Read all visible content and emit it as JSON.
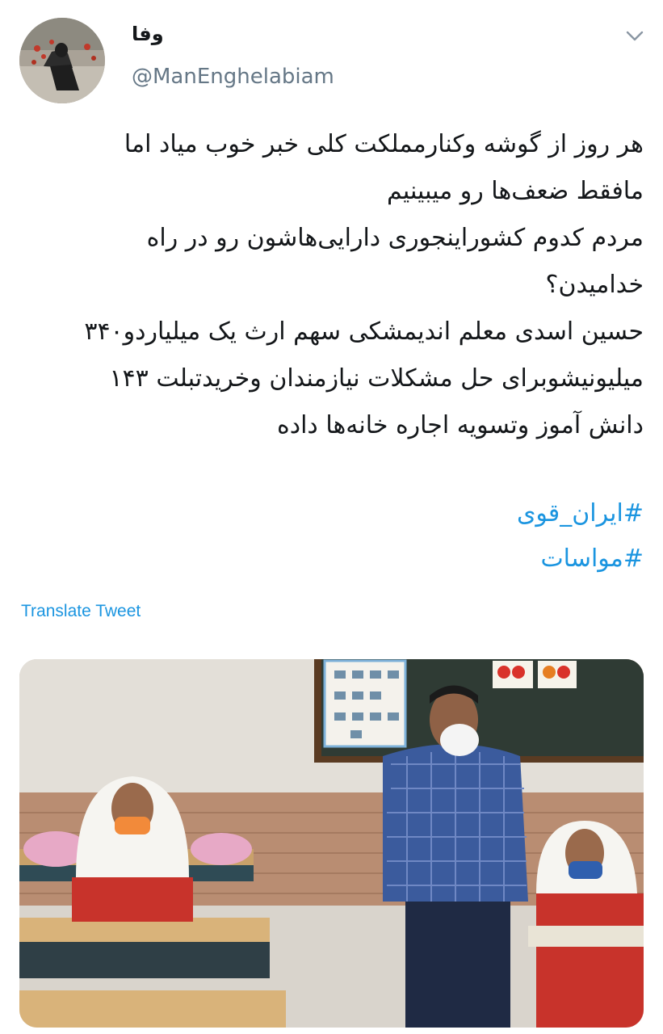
{
  "author": {
    "display_name": "وفا",
    "handle": "@ManEnghelabiam",
    "avatar_icon": "avatar-photo"
  },
  "menu": {
    "caret_icon": "chevron-down-icon"
  },
  "tweet": {
    "lines": [
      "هر روز از گوشه وکنارمملکت کلی خبر خوب میاد اما",
      "مافقط ضعف‌ها رو میبینیم",
      " مردم کدوم کشوراینجوری دارایی‌هاشون رو در راه",
      "خدامیدن؟",
      "حسین اسدی معلم اندیمشکی سهم ارث یک میلیاردو۳۴۰",
      "میلیونیشوبرای حل مشکلات نیازمندان وخریدتبلت ۱۴۳",
      "دانش آموز وتسویه اجاره خانه‌ها داده"
    ],
    "hashtags": [
      "#ایران_قوی",
      "#مواسات"
    ],
    "translate_label": "Translate Tweet"
  },
  "colors": {
    "link": "#1b95e0",
    "text": "#14171a",
    "secondary": "#657786"
  }
}
